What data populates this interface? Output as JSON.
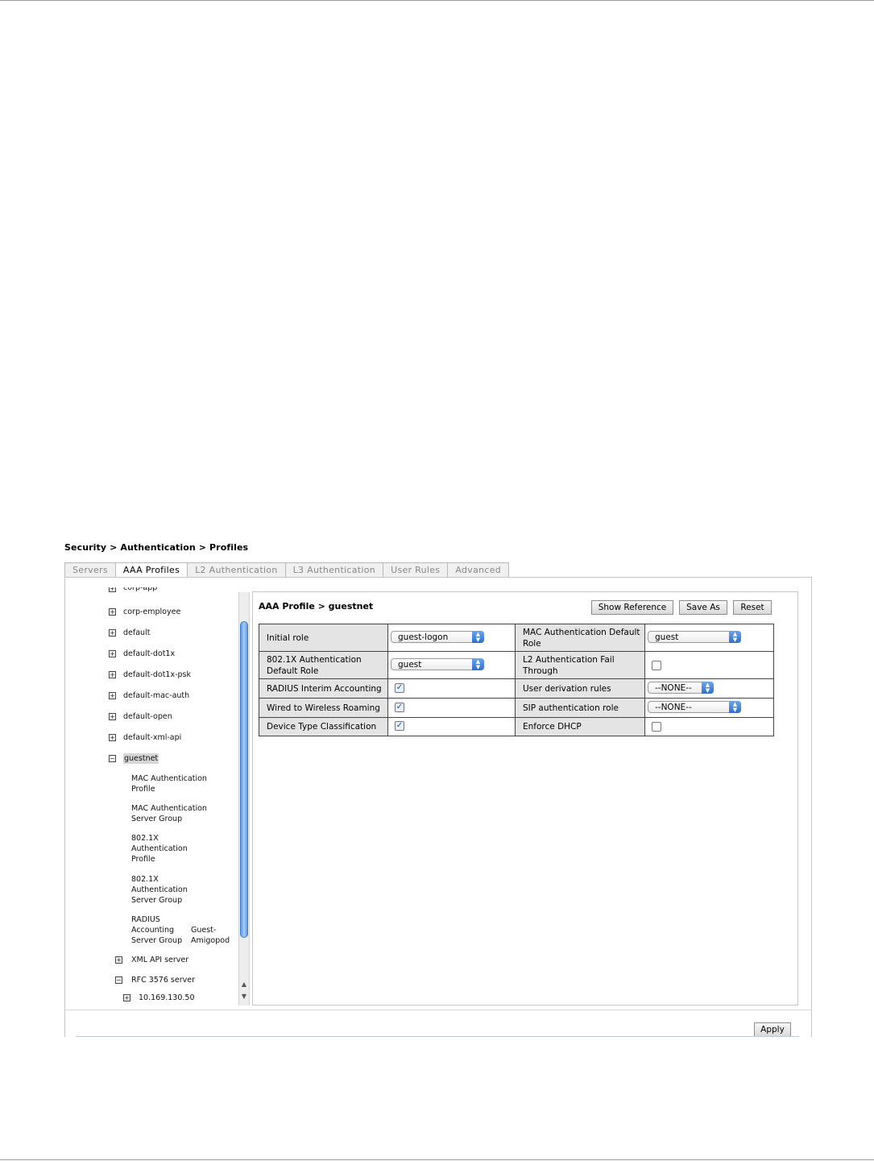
{
  "breadcrumb": "Security > Authentication > Profiles",
  "tabs": [
    "Servers",
    "AAA Profiles",
    "L2 Authentication",
    "L3 Authentication",
    "User Rules",
    "Advanced"
  ],
  "active_tab": "AAA Profiles",
  "tree": {
    "items": [
      {
        "label": "corp-app",
        "expander": "+"
      },
      {
        "label": "corp-employee",
        "expander": "+"
      },
      {
        "label": "default",
        "expander": "+"
      },
      {
        "label": "default-dot1x",
        "expander": "+"
      },
      {
        "label": "default-dot1x-psk",
        "expander": "+"
      },
      {
        "label": "default-mac-auth",
        "expander": "+"
      },
      {
        "label": "default-open",
        "expander": "+"
      },
      {
        "label": "default-xml-api",
        "expander": "+"
      },
      {
        "label": "guestnet",
        "expander": "−"
      }
    ],
    "children": [
      {
        "label": "MAC Authentication\nProfile"
      },
      {
        "label": "MAC Authentication\nServer Group"
      },
      {
        "label": "802.1X\nAuthentication\nProfile"
      },
      {
        "label": "802.1X\nAuthentication\nServer Group"
      },
      {
        "label": "RADIUS\nAccounting\nServer Group",
        "value": "Guest-\nAmigopod"
      },
      {
        "label": "XML API server",
        "expander": "+"
      },
      {
        "label": "RFC 3576 server",
        "expander": "−"
      },
      {
        "label": "10.169.130.50",
        "expander": "+"
      }
    ]
  },
  "panel": {
    "title": "AAA Profile > guestnet",
    "buttons": {
      "show_reference": "Show Reference",
      "save_as": "Save As",
      "reset": "Reset"
    }
  },
  "fields": {
    "initial_role": {
      "label": "Initial role",
      "value": "guest-logon"
    },
    "mac_default_role": {
      "label": "MAC Authentication Default Role",
      "value": "guest"
    },
    "dot1x_default_role": {
      "label": "802.1X Authentication Default Role",
      "value": "guest"
    },
    "l2_fail_through": {
      "label": "L2 Authentication Fail Through",
      "checked": false
    },
    "radius_interim": {
      "label": "RADIUS Interim Accounting",
      "checked": true
    },
    "user_derivation": {
      "label": "User derivation rules",
      "value": "--NONE--"
    },
    "wired_roaming": {
      "label": "Wired to Wireless Roaming",
      "checked": true
    },
    "sip_role": {
      "label": "SIP authentication role",
      "value": "--NONE--"
    },
    "device_type": {
      "label": "Device Type Classification",
      "checked": true
    },
    "enforce_dhcp": {
      "label": "Enforce DHCP",
      "checked": false
    }
  },
  "apply_label": "Apply",
  "colors": {
    "scroll_thumb": "#5d9ae6",
    "select_arrow": "#2c6fd1",
    "label_bg": "#e4e4e4"
  }
}
